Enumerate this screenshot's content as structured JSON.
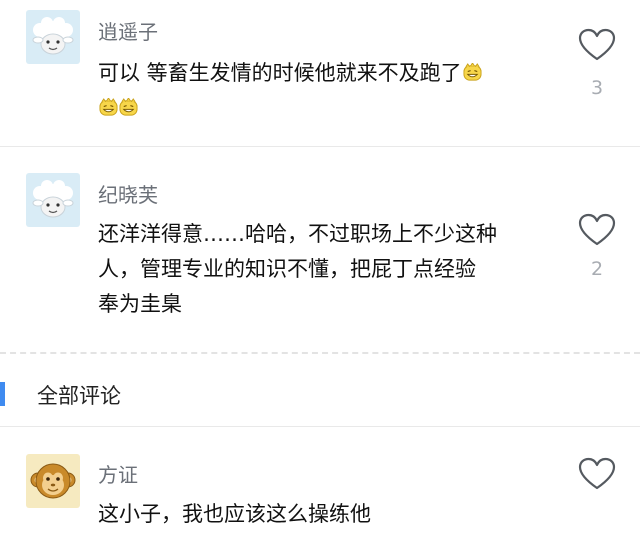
{
  "colors": {
    "accent": "#3f8bf0",
    "username": "#6b7078",
    "count": "#a8acb2"
  },
  "comments_top": [
    {
      "avatar_icon": "sheep-avatar-icon",
      "username": "逍遥子",
      "text": "可以 等畜生发情的时候他就来不及跑了",
      "trailing_emoji_count": 3,
      "like_icon": "heart-outline-icon",
      "likes": "3"
    },
    {
      "avatar_icon": "sheep-avatar-icon",
      "username": "纪晓芙",
      "text_lines": [
        "还洋洋得意……哈哈，不过职场上不少这种",
        "人，管理专业的知识不懂，把屁丁点经验",
        "奉为圭臬"
      ],
      "like_icon": "heart-outline-icon",
      "likes": "2"
    }
  ],
  "section": {
    "title": "全部评论"
  },
  "comments_all": [
    {
      "avatar_icon": "monkey-avatar-icon",
      "username": "方证",
      "text": "这小子，我也应该这么操练他",
      "like_icon": "heart-outline-icon"
    }
  ]
}
